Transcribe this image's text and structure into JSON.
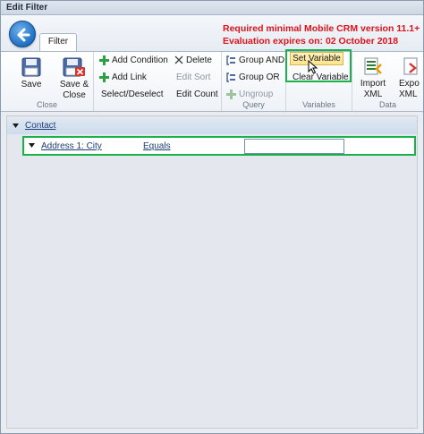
{
  "window": {
    "title": "Edit Filter"
  },
  "tabs": [
    {
      "label": "Filter"
    }
  ],
  "notice": {
    "line1": "Required minimal Mobile CRM version 11.1+",
    "line2": "Evaluation expires on: 02 October 2018",
    "color": "#e0121a"
  },
  "ribbon": {
    "close_group": {
      "label": "Close",
      "save": "Save",
      "save_close_line1": "Save &",
      "save_close_line2": "Close"
    },
    "edit_group": {
      "add_condition": "Add Condition",
      "add_link": "Add Link",
      "select_deselect": "Select/Deselect",
      "delete": "Delete",
      "edit_sort": "Edit Sort",
      "edit_count": "Edit Count"
    },
    "query_group": {
      "label": "Query",
      "group_and": "Group AND",
      "group_or": "Group OR",
      "ungroup": "Ungroup"
    },
    "variables_group": {
      "label": "Variables",
      "set_variable": "Set Variable",
      "clear_variable": "Clear Variable"
    },
    "data_group": {
      "label": "Data",
      "import_line1": "Import",
      "import_line2": "XML",
      "export_line1": "Expo",
      "export_line2": "XML"
    }
  },
  "tree": {
    "entity": "Contact",
    "condition": {
      "field": "Address 1: City",
      "operator": "Equals",
      "value": ""
    }
  },
  "colors": {
    "highlight_box": "#1bb14a",
    "accent_blue": "#1f6fc4"
  }
}
